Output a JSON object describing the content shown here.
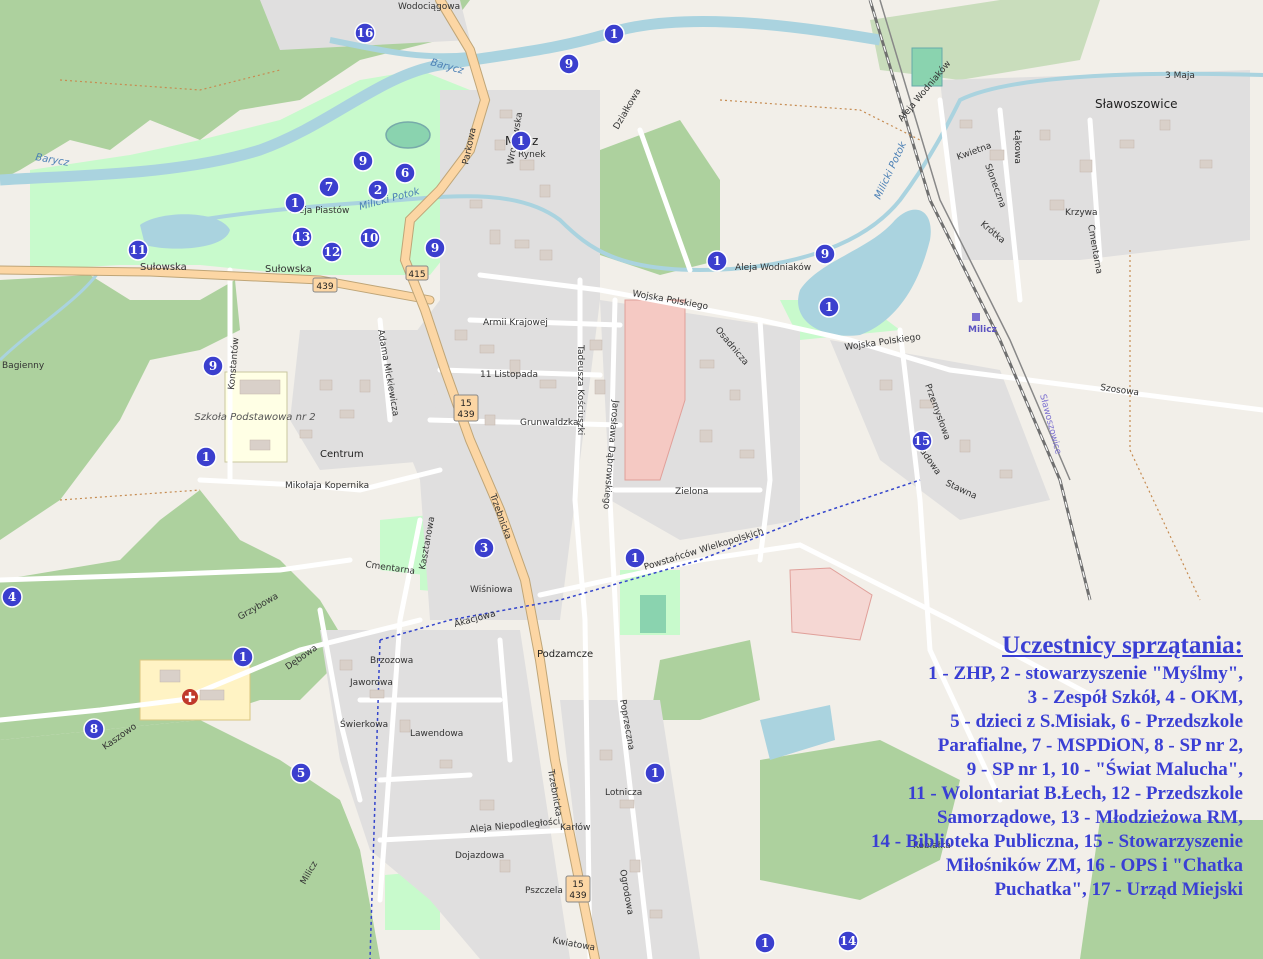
{
  "legend": {
    "title": "Uczestnicy sprzątania:",
    "lines": [
      "1 - ZHP, 2 - stowarzyszenie \"Myślmy\",",
      "3 - Zespół Szkół, 4 - OKM,",
      "5 - dzieci z S.Misiak, 6 - Przedszkole",
      "Parafialne, 7 - MSPDiON, 8 - SP nr 2,",
      "9 - SP nr 1, 10 - \"Świat Malucha\",",
      "11 - Wolontariat B.Łech, 12 - Przedszkole",
      "Samorządowe, 13 - Młodzieżowa RM,",
      "14 - Biblioteka Publiczna, 15 - Stowarzyszenie",
      "Miłośników ZM, 16 - OPS i \"Chatka",
      "Puchatka\", 17 - Urząd Miejski"
    ]
  },
  "places": {
    "town": "Milicz",
    "village": "Sławoszowice",
    "station": "Milicz",
    "district_centre": "Centrum",
    "bagienny": "Bagienny",
    "podzamcze": "Podzamcze",
    "kobialka": "Kobiałka",
    "school": "Szkoła Podstawowa nr 2",
    "sign_slawoszowice": "Sławoszowice",
    "milicz_bottom": "Milicz"
  },
  "water": {
    "barycz_1": "Barycz",
    "barycz_2": "Barycz",
    "potok_1": "Milicki Potok",
    "potok_2": "Milicki Potok"
  },
  "streets": {
    "sulowska_1": "Sułowska",
    "sulowska_2": "Sułowska",
    "parkowa": "Parkowa",
    "trzebnicka_1": "Trzebnicka",
    "trzebnicka_2": "Trzebnicka",
    "wojska_1": "Wojska Polskiego",
    "wojska_2": "Wojska Polskiego",
    "wodniakow_1": "Aleja Wodniaków",
    "wodniakow_2": "Aleja Wodniaków",
    "armii": "Armii Krajowej",
    "listopada": "11 Listopada",
    "grunwaldzka": "Grunwaldzka",
    "kopernika": "Mikołaja Kopernika",
    "zielona": "Zielona",
    "powstancow": "Powstańców Wielkopolskich",
    "cmentarna": "Cmentarna",
    "grzybowa": "Grzybowa",
    "kasztanowa": "Kasztanowa",
    "wisniowa": "Wiśniowa",
    "akacjowa": "Akacjowa",
    "brzozowa": "Brzozowa",
    "jaworowa": "Jaworowa",
    "swierkowa": "Świerkowa",
    "lawendowa": "Lawendowa",
    "niepodleglosci": "Aleja Niepodległości",
    "dojazdowa": "Dojazdowa",
    "pszczela": "Pszczela",
    "karlow": "Karłów",
    "kwiatowa": "Kwiatowa",
    "ogrodowa": "Ogrodowa",
    "poprzeczna": "Poprzeczna",
    "lotnicza": "Lotnicza",
    "kosciuszki": "Tadeusza Kościuszki",
    "dabrowskiego": "Jarosława Dąbrowskiego",
    "szosowa": "Szosowa",
    "skladowa": "Składowa",
    "stawna": "Stawna",
    "przemyslowa": "Przemysłowa",
    "osadnicza": "Osadnicza",
    "dzialkowa": "Działkowa",
    "trzy_maja": "3 Maja",
    "lakowa": "Łąkowa",
    "kwietna": "Kwietna",
    "sloneczna": "Słoneczna",
    "krzywa": "Krzywa",
    "cmentarna2": "Cmentarna",
    "krotka": "Krótka",
    "aleja_piastow": "Aleja Piastów",
    "kostantow": "Konstantów",
    "mickiewicza": "Adama Mickiewicza",
    "rynek": "Rynek",
    "debowa": "Dębowa",
    "kaszowo": "Kaszowo",
    "wroclawska": "Wrocławska",
    "wodociagowa": "Wodociągowa"
  },
  "road_shields": {
    "s415_top": "415",
    "s439_left": "439",
    "s15_mid": "15",
    "s439_mid": "439",
    "s15_bottom": "15",
    "s439_bottom": "439"
  },
  "markers": {
    "m16": "16",
    "m1_top": "1",
    "m9_top": "9",
    "m1_rynek": "1",
    "m9_park": "9",
    "m6": "6",
    "m7": "7",
    "m2": "2",
    "m1_park": "1",
    "m13": "13",
    "m12": "12",
    "m10": "10",
    "m9_mid": "9",
    "m11": "11",
    "m1_wodniakow": "1",
    "m9_right": "9",
    "m1_lake": "1",
    "m9_left": "9",
    "m1_centrum": "1",
    "m15": "15",
    "m3": "3",
    "m1_zielona": "1",
    "m4": "4",
    "m1_grzybowa": "1",
    "m8": "8",
    "m5": "5",
    "m1_trzebnicka": "1",
    "m1_bottom": "1",
    "m14": "14"
  },
  "colors": {
    "land": "#f2efe9",
    "forest": "#add19e",
    "park": "#c8facc",
    "water": "#aad3df",
    "primary_road": "#fcd6a4",
    "marker": "#3b3fce",
    "legend_text": "#3a3fd4",
    "hospital": "#c0392b"
  }
}
